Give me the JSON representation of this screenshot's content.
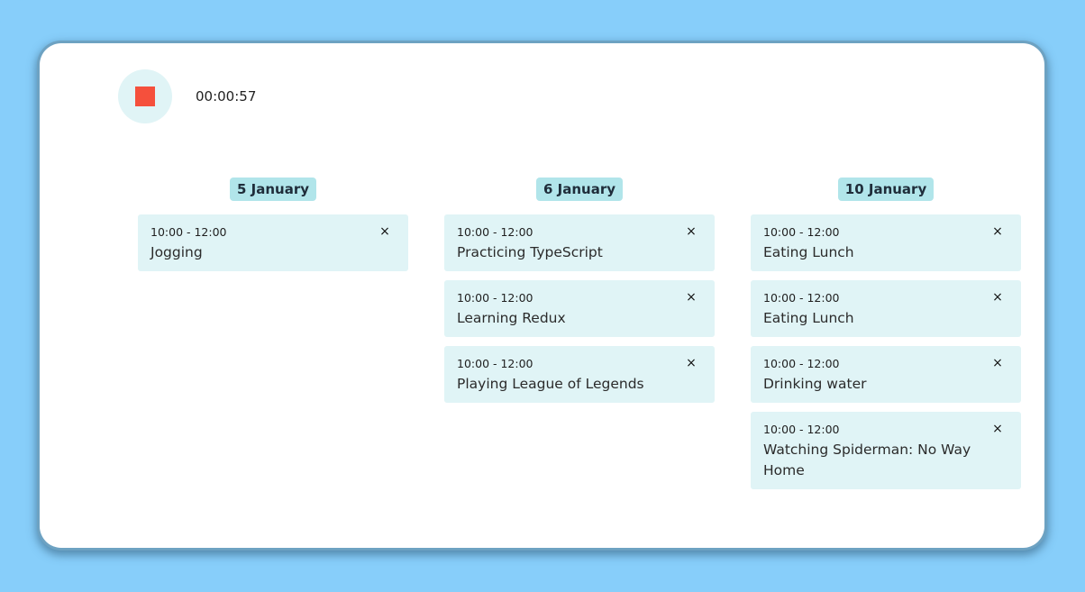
{
  "timer": {
    "elapsed": "00:00:57",
    "stop_icon_color": "#f5503c"
  },
  "columns": [
    {
      "date": "5 January",
      "entries": [
        {
          "time": "10:00 - 12:00",
          "title": "Jogging",
          "close": "×"
        }
      ]
    },
    {
      "date": "6 January",
      "entries": [
        {
          "time": "10:00 - 12:00",
          "title": "Practicing TypeScript",
          "close": "×"
        },
        {
          "time": "10:00 - 12:00",
          "title": "Learning Redux",
          "close": "×"
        },
        {
          "time": "10:00 - 12:00",
          "title": "Playing League of Legends",
          "close": "×"
        }
      ]
    },
    {
      "date": "10 January",
      "entries": [
        {
          "time": "10:00 - 12:00",
          "title": "Eating Lunch",
          "close": "×"
        },
        {
          "time": "10:00 - 12:00",
          "title": "Eating Lunch",
          "close": "×"
        },
        {
          "time": "10:00 - 12:00",
          "title": "Drinking water",
          "close": "×"
        },
        {
          "time": "10:00 - 12:00",
          "title": "Watching Spiderman: No Way Home",
          "close": "×"
        }
      ]
    }
  ],
  "colors": {
    "background": "#87cefa",
    "card": "#ffffff",
    "entry_bg": "#e0f4f6",
    "header_bg": "#b1e5ea"
  }
}
